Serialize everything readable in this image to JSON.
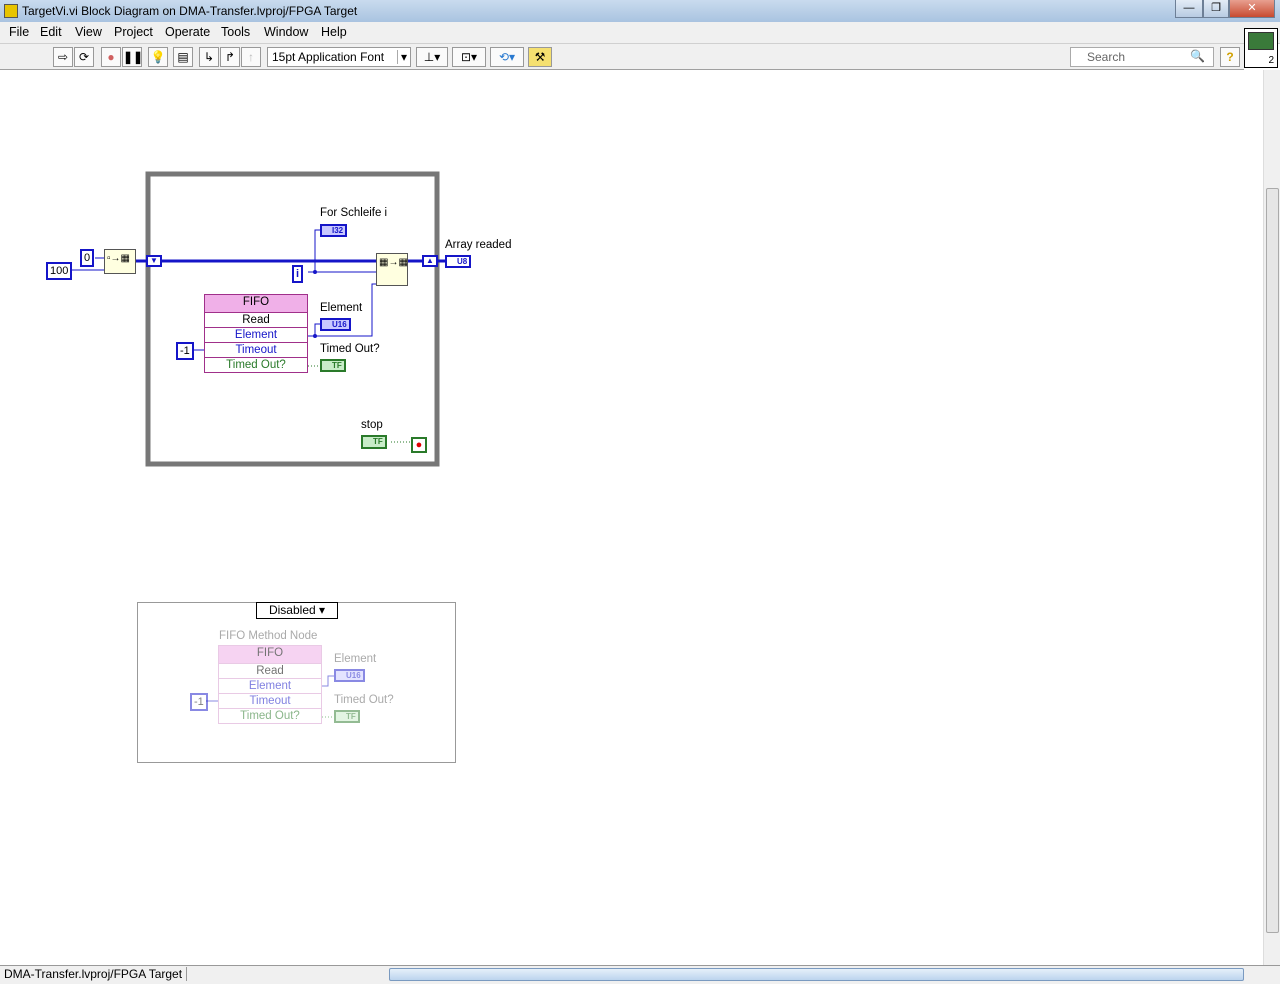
{
  "window": {
    "title": "TargetVi.vi Block Diagram on DMA-Transfer.lvproj/FPGA Target",
    "minimize": "—",
    "restore": "❐",
    "close": "✕"
  },
  "menu": [
    "File",
    "Edit",
    "View",
    "Project",
    "Operate",
    "Tools",
    "Window",
    "Help"
  ],
  "toolbar": {
    "font": "15pt Application Font",
    "search_placeholder": "Search",
    "help": "?",
    "connector_num": "2"
  },
  "diagram": {
    "const_100": "100",
    "const_0": "0",
    "const_neg1": "-1",
    "iter": "i",
    "for_label": "For Schleife i",
    "for_type": "I32",
    "array_label": "Array readed",
    "array_type": "U8",
    "fifo": {
      "title": "FIFO",
      "method": "Read",
      "rows": [
        "Element",
        "Timeout",
        "Timed Out?"
      ]
    },
    "element_label": "Element",
    "element_type": "U16",
    "timed_label": "Timed Out?",
    "timed_type": "TF",
    "stop_label": "stop",
    "stop_type": "TF"
  },
  "disabled": {
    "selector": "Disabled",
    "node_label": "FIFO Method Node",
    "fifo": {
      "title": "FIFO",
      "method": "Read",
      "rows": [
        "Element",
        "Timeout",
        "Timed Out?"
      ]
    },
    "const_neg1": "-1",
    "element_label": "Element",
    "element_type": "U16",
    "timed_label": "Timed Out?",
    "timed_type": "TF"
  },
  "status": {
    "context": "DMA-Transfer.lvproj/FPGA Target"
  }
}
